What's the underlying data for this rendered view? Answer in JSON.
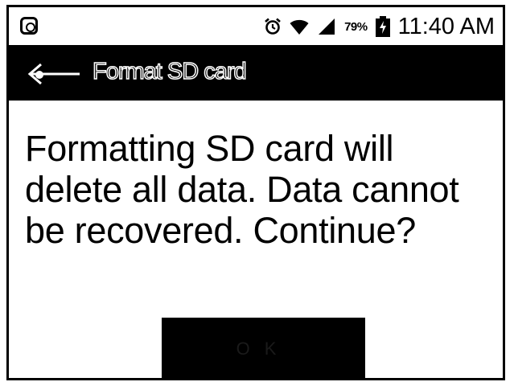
{
  "status_bar": {
    "left_icon": "app-notification-icon",
    "icons": [
      "alarm-clock-icon",
      "wifi-icon",
      "cell-signal-icon",
      "battery-charging-icon"
    ],
    "battery_percent": "79%",
    "time": "11:40 AM"
  },
  "title_bar": {
    "back_icon": "back-arrow-icon",
    "title": "Format SD card"
  },
  "dialog": {
    "message": "Formatting SD card will delete all data. Data cannot be recovered. Continue?",
    "confirm_button_label": "OK"
  },
  "colors": {
    "background": "#ffffff",
    "title_bar": "#000000",
    "text": "#000000",
    "button": "#000000"
  }
}
